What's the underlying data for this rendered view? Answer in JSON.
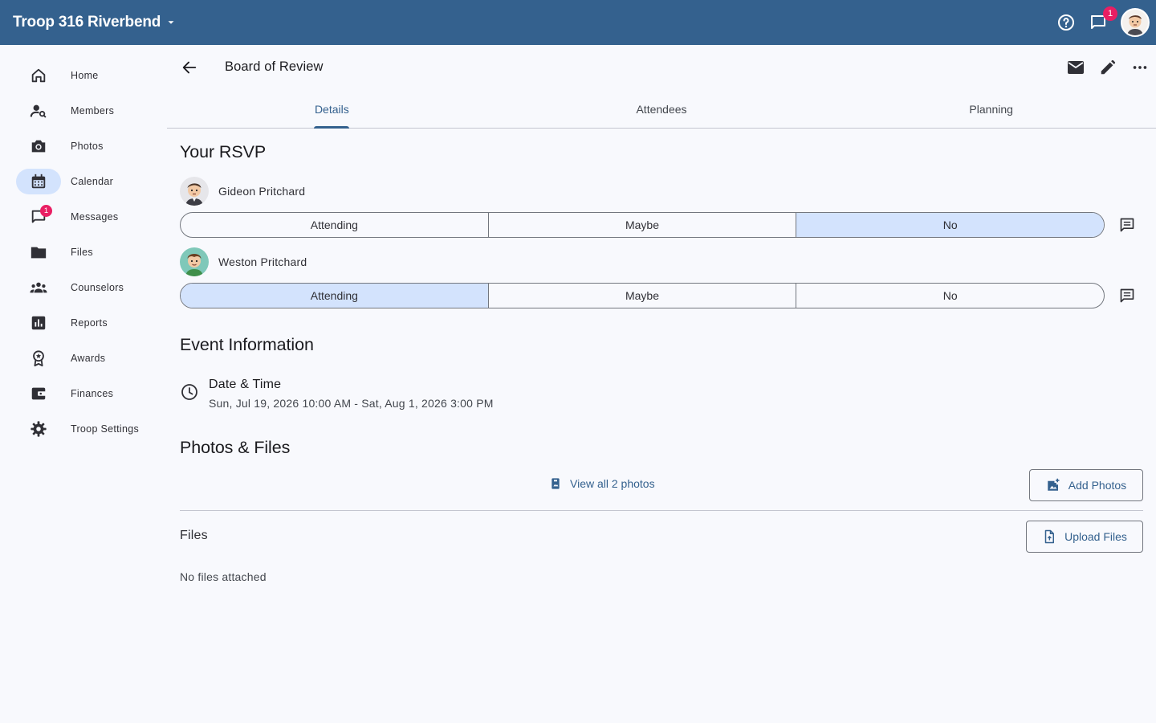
{
  "app": {
    "troop_name": "Troop 316 Riverbend",
    "notification_count": "1"
  },
  "colors": {
    "primary": "#34618e",
    "selected": "#d3e3fd",
    "badge": "#e91e63",
    "background": "#f8f9fd"
  },
  "sidebar": {
    "items": [
      {
        "label": "Home",
        "icon": "home-icon"
      },
      {
        "label": "Members",
        "icon": "person-search-icon"
      },
      {
        "label": "Photos",
        "icon": "camera-icon"
      },
      {
        "label": "Calendar",
        "icon": "calendar-icon",
        "active": true
      },
      {
        "label": "Messages",
        "icon": "chat-icon",
        "badge": "1"
      },
      {
        "label": "Files",
        "icon": "folder-icon"
      },
      {
        "label": "Counselors",
        "icon": "groups-icon"
      },
      {
        "label": "Reports",
        "icon": "bar-chart-icon"
      },
      {
        "label": "Awards",
        "icon": "award-icon"
      },
      {
        "label": "Finances",
        "icon": "wallet-icon"
      },
      {
        "label": "Troop Settings",
        "icon": "gear-icon"
      }
    ]
  },
  "event": {
    "title": "Board of Review"
  },
  "tabs": [
    {
      "label": "Details",
      "active": true
    },
    {
      "label": "Attendees"
    },
    {
      "label": "Planning"
    }
  ],
  "rsvp": {
    "title": "Your RSVP",
    "options": [
      "Attending",
      "Maybe",
      "No"
    ],
    "people": [
      {
        "name": "Gideon Pritchard",
        "selected": "No"
      },
      {
        "name": "Weston Pritchard",
        "selected": "Attending"
      }
    ]
  },
  "event_info": {
    "title": "Event Information",
    "date_label": "Date & Time",
    "date_value": "Sun, Jul 19, 2026 10:00 AM - Sat, Aug 1, 2026 3:00 PM"
  },
  "photos_files": {
    "title": "Photos & Files",
    "view_photos": "View all 2 photos",
    "add_photos": "Add Photos",
    "files_label": "Files",
    "upload_files": "Upload Files",
    "no_files": "No files attached"
  }
}
